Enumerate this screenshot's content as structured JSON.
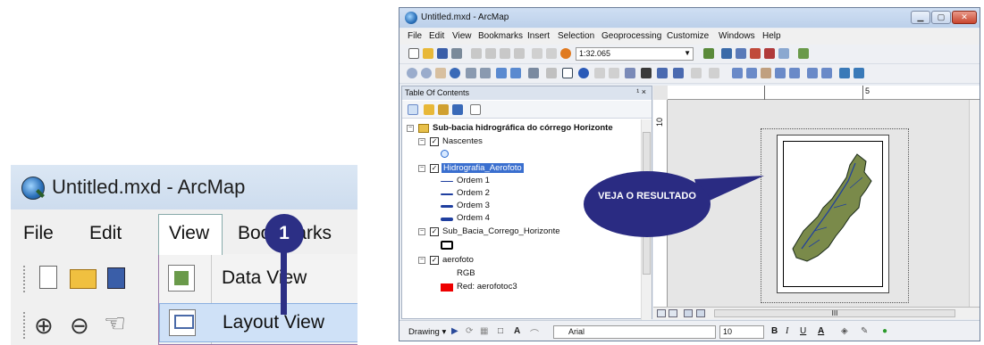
{
  "zoom": {
    "title": "Untitled.mxd - ArcMap",
    "menu": [
      "File",
      "Edit",
      "View",
      "Bookmarks"
    ],
    "dropdown": [
      "Data View",
      "Layout View"
    ],
    "step": "1"
  },
  "window": {
    "title": "Untitled.mxd - ArcMap",
    "menu": [
      "File",
      "Edit",
      "View",
      "Bookmarks",
      "Insert",
      "Selection",
      "Geoprocessing",
      "Customize",
      "Windows",
      "Help"
    ],
    "scale": "1:32.065"
  },
  "toc": {
    "title": "Table Of Contents",
    "pin": "¹ ×",
    "group": "Sub-bacia hidrográfica do córrego Horizonte",
    "layers": {
      "nascentes": "Nascentes",
      "hidro": "Hidrografia_Aerofoto",
      "ordem1": "Ordem 1",
      "ordem2": "Ordem 2",
      "ordem3": "Ordem 3",
      "ordem4": "Ordem 4",
      "subbacia": "Sub_Bacia_Corrego_Horizonte",
      "aerofoto": "aerofoto",
      "rgb": "RGB",
      "red": "Red:  aerofotoc3"
    }
  },
  "layout": {
    "ruler_top": "5",
    "ruler_left": "10",
    "callout": "VEJA O RESULTADO",
    "hscroll": "III"
  },
  "drawing": {
    "label": "Drawing ▾",
    "font": "Arial",
    "size": "10",
    "bold": "B",
    "italic": "I",
    "underline": "U",
    "fontcolor": "A"
  },
  "colors": {
    "callout": "#2a2b82",
    "selection": "#3a6fcf",
    "red_band": "#ee0000"
  }
}
